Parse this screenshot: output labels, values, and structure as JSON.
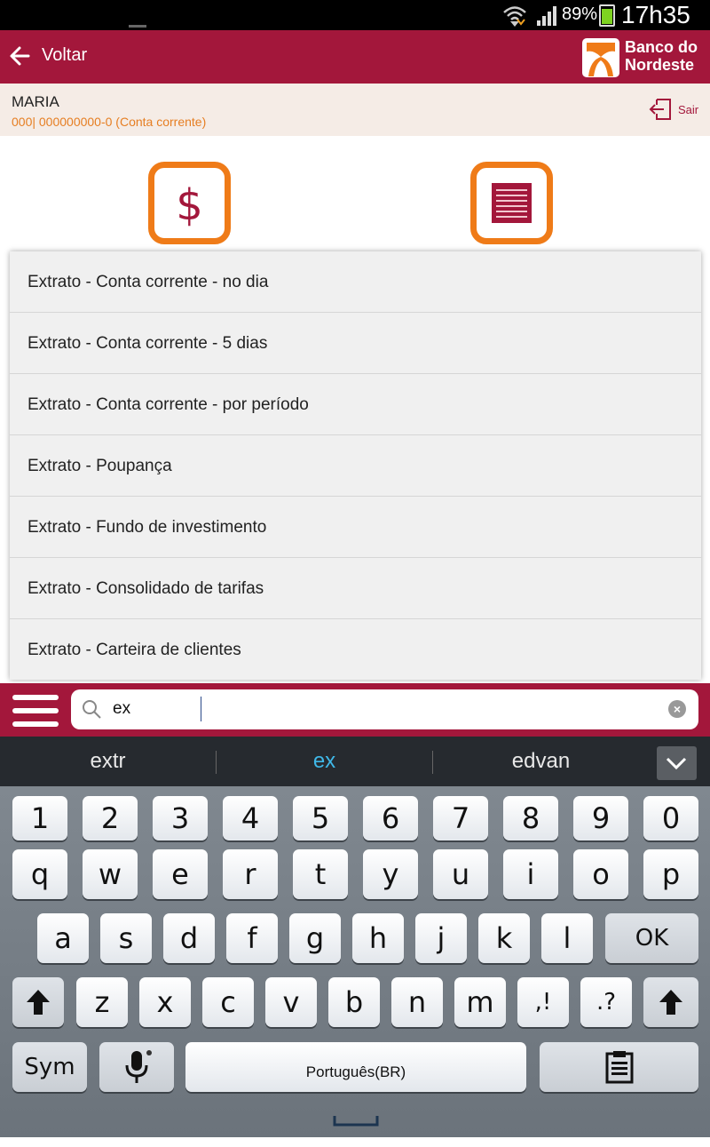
{
  "status_bar": {
    "battery": "89%",
    "time": "17h35"
  },
  "header": {
    "back_label": "Voltar",
    "brand_line1": "Banco do",
    "brand_line2": "Nordeste"
  },
  "user": {
    "name": "MARIA",
    "account": "000| 000000000-0 (Conta corrente)",
    "logout_label": "Sair"
  },
  "tiles": [
    {
      "icon": "dollar-icon",
      "glyph": "$"
    },
    {
      "icon": "statement-icon"
    }
  ],
  "dropdown": {
    "items": [
      "Extrato - Conta corrente - no dia",
      "Extrato - Conta corrente - 5 dias",
      "Extrato - Conta corrente - por período",
      "Extrato - Poupança",
      "Extrato - Fundo de investimento",
      "Extrato - Consolidado de tarifas",
      "Extrato - Carteira de clientes"
    ]
  },
  "search": {
    "value": "ex"
  },
  "suggestions": [
    "extr",
    "ex",
    "edvan"
  ],
  "keyboard": {
    "row_numbers": [
      "1",
      "2",
      "3",
      "4",
      "5",
      "6",
      "7",
      "8",
      "9",
      "0"
    ],
    "row_top": [
      "q",
      "w",
      "e",
      "r",
      "t",
      "y",
      "u",
      "i",
      "o",
      "p"
    ],
    "row_home": [
      "a",
      "s",
      "d",
      "f",
      "g",
      "h",
      "j",
      "k",
      "l"
    ],
    "ok": "OK",
    "row_bottom": [
      "z",
      "x",
      "c",
      "v",
      "b",
      "n",
      "m"
    ],
    "sym": "Sym",
    "space_label": "Português(BR)",
    "punct_1": ",!",
    "punct_2": ".?"
  },
  "colors": {
    "brand": "#a3173b",
    "accent": "#ef7b18",
    "highlight": "#3fb8e8"
  }
}
